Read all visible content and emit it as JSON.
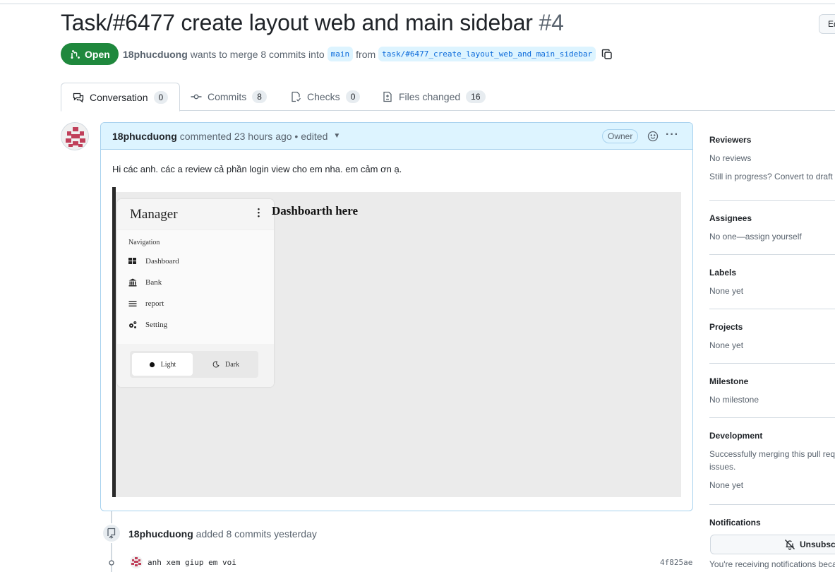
{
  "pr": {
    "title": "Task/#6477 create layout web and main sidebar",
    "number": "#4",
    "state": "Open",
    "author": "18phucduong",
    "merge_text": "wants to merge 8 commits into",
    "base_branch": "main",
    "from_text": "from",
    "head_branch": "task/#6477_create_layout_web_and_main_sidebar",
    "edit_label": "Ed"
  },
  "tabs": [
    {
      "label": "Conversation",
      "count": "0",
      "icon": "comment-discussion-icon"
    },
    {
      "label": "Commits",
      "count": "8",
      "icon": "git-commit-icon"
    },
    {
      "label": "Checks",
      "count": "0",
      "icon": "checklist-icon"
    },
    {
      "label": "Files changed",
      "count": "16",
      "icon": "file-diff-icon"
    }
  ],
  "comment": {
    "author": "18phucduong",
    "meta": "commented 23 hours ago • edited",
    "role": "Owner",
    "body": "Hi các anh. các a review cả phần login view cho em nha. em cảm ơn ạ.",
    "screenshot": {
      "sidebar_title": "Manager",
      "nav_label": "Navigation",
      "items": [
        "Dashboard",
        "Bank",
        "report",
        "Setting"
      ],
      "theme_light": "Light",
      "theme_dark": "Dark",
      "heading": "Dashboarth here"
    }
  },
  "timeline": {
    "author": "18phucduong",
    "event": "added 8 commits yesterday",
    "commit_message": "anh xem giup em voi",
    "commit_sha": "4f825ae"
  },
  "sidebar": {
    "reviewers": {
      "title": "Reviewers",
      "value": "No reviews",
      "extra": "Still in progress? Convert to draft"
    },
    "assignees": {
      "title": "Assignees",
      "value": "No one—assign yourself"
    },
    "labels": {
      "title": "Labels",
      "value": "None yet"
    },
    "projects": {
      "title": "Projects",
      "value": "None yet"
    },
    "milestone": {
      "title": "Milestone",
      "value": "No milestone"
    },
    "development": {
      "title": "Development",
      "value_line1": "Successfully merging this pull req",
      "value_line2": "issues.",
      "value_line3": "None yet"
    },
    "notifications": {
      "title": "Notifications",
      "button": "Unsubscri",
      "note": "You're receiving notifications beca"
    }
  },
  "colors": {
    "open_green": "#1f883d",
    "comment_header": "#ddf4ff",
    "link_blue": "#0969da"
  }
}
